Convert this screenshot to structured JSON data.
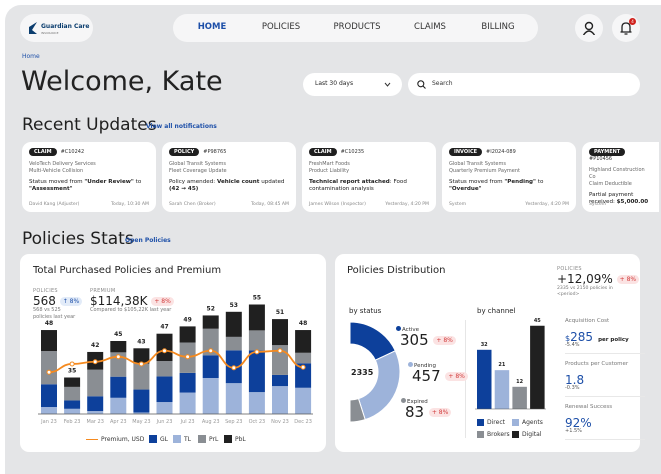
{
  "header": {
    "logo_text": "Guardian Care",
    "logo_sub": "INSURANCE",
    "nav": [
      "HOME",
      "POLICIES",
      "PRODUCTS",
      "CLAIMS",
      "BILLING"
    ],
    "active": "HOME",
    "notification_count": "4"
  },
  "breadcrumb": "Home",
  "welcome": "Welcome, Kate",
  "period_select": "Last 30 days",
  "search_placeholder": "Search",
  "recent": {
    "title": "Recent Updates",
    "link": "View all notifications",
    "cards": [
      {
        "tag": "CLAIM",
        "id": "#C10242",
        "company": "VeloTech Delivery Services",
        "subject": "Multi-Vehicle Collision",
        "msg_pre": "Status moved from ",
        "msg_b1": "\"Under Review\"",
        "msg_mid": " to ",
        "msg_b2": "\"Assessment\"",
        "author": "David Kang (Adjuster)",
        "time": "Today, 10:30 AM"
      },
      {
        "tag": "POLICY",
        "id": "#P98765",
        "company": "Global Transit Systems",
        "subject": "Fleet Coverage Update",
        "msg_pre": "Policy amended: ",
        "msg_b1": "Vehicle count",
        "msg_mid": " updated ",
        "msg_b2": "(42 → 45)",
        "author": "Sarah Chen (Broker)",
        "time": "Today, 08:45 AM"
      },
      {
        "tag": "CLAIM",
        "id": "#C10235",
        "company": "FreshMart Foods",
        "subject": "Product Liability",
        "msg_pre": "",
        "msg_b1": "Technical report attached",
        "msg_mid": ": Food contamination analysis",
        "msg_b2": "",
        "author": "James Wilson (Inspector)",
        "time": "Yesterday, 4:20 PM"
      },
      {
        "tag": "INVOICE",
        "id": "#I2024-089",
        "company": "Global Transit Systems",
        "subject": "Quarterly Premium Payment",
        "msg_pre": "Status moved from ",
        "msg_b1": "\"Pending\"",
        "msg_mid": " to ",
        "msg_b2": "\"Overdue\"",
        "author": "System",
        "time": "Yesterday, 4:20 PM"
      },
      {
        "tag": "PAYMENT",
        "id": "#P10456",
        "company": "Highland Construction Co",
        "subject": "Claim Deductible",
        "msg_pre": "Partial payment received: ",
        "msg_b1": "",
        "msg_mid": "",
        "msg_b2": "$5,000.00",
        "author": "System",
        "time": ""
      }
    ]
  },
  "stats": {
    "title": "Policies Stats",
    "link": "Open Policies"
  },
  "purchased": {
    "title": "Total Purchased Policies and Premium",
    "policies_label": "POLICIES",
    "policies_value": "568",
    "policies_change": "↑ 8%",
    "policies_sub": "568 vs 525 policies last year",
    "premium_label": "PREMIUM",
    "premium_value": "$114,38K",
    "premium_change": "+ 8%",
    "premium_sub": "Compared to $105,22K  last year"
  },
  "distribution": {
    "title": "Policies Distribution",
    "by_status": "by status",
    "by_channel": "by channel",
    "total": "2335",
    "status": [
      {
        "name": "Active",
        "value": "305",
        "change": "+ 8%"
      },
      {
        "name": "Pending",
        "value": "457",
        "change": "+ 8%"
      },
      {
        "name": "Expired",
        "value": "83",
        "change": "+ 8%"
      }
    ]
  },
  "side": {
    "policies_label": "POLICIES",
    "policies_value": "+12,09%",
    "policies_change": "+ 8%",
    "policies_sub": "2335 vs 2150 policies in <period>",
    "metrics": [
      {
        "label": "Acquisition Cost",
        "currency": "$",
        "value": "285",
        "unit": "per policy",
        "change": "-5.4%"
      },
      {
        "label": "Products per Customer",
        "currency": "",
        "value": "1.8",
        "unit": "",
        "change": "-0.3%"
      },
      {
        "label": "Renewal Success",
        "currency": "",
        "value": "92%",
        "unit": "",
        "change": "+1.5%"
      }
    ]
  },
  "colors": {
    "GL": "#0d409b",
    "TL": "#9db3da",
    "PrL": "#8a8e93",
    "PbL": "#202020",
    "premium": "#f58a1f",
    "accent": "#1d4fa8",
    "bg": "#e4e5e7"
  },
  "chart_data": [
    {
      "type": "bar",
      "stacked": true,
      "categories": [
        "Jan 23",
        "Feb 23",
        "Mar 23",
        "Apr 23",
        "May 23",
        "Jun 23",
        "Jul 23",
        "Aug 23",
        "Sep 23",
        "Oct 23",
        "Nov 23",
        "Dec 23"
      ],
      "totals": [
        48,
        35,
        42,
        45,
        43,
        47,
        49,
        52,
        53,
        55,
        51,
        48
      ],
      "series": [
        {
          "name": "GL",
          "values": [
            13,
            8,
            10,
            13,
            15,
            15,
            11,
            12,
            17,
            21,
            6,
            14
          ]
        },
        {
          "name": "TL",
          "values": [
            4,
            5,
            2,
            10,
            1,
            7,
            12,
            19,
            16,
            11,
            15,
            15
          ]
        },
        {
          "name": "PrL",
          "values": [
            19,
            13,
            18,
            15,
            17,
            9,
            17,
            14,
            7,
            10,
            16,
            6
          ]
        },
        {
          "name": "PbL",
          "values": [
            12,
            9,
            12,
            7,
            10,
            16,
            9,
            7,
            13,
            13,
            14,
            13
          ]
        }
      ],
      "line": {
        "name": "Premium, USD",
        "values": [
          7.6,
          9.1,
          9.5,
          10.4,
          9.1,
          11.5,
          10.4,
          11.5,
          8.4,
          11.3,
          11.5,
          8.5
        ]
      },
      "ylim": [
        25,
        57
      ],
      "legend": "bottom",
      "grid": false
    },
    {
      "type": "pie",
      "donut": true,
      "labels": [
        "Active",
        "Pending",
        "Expired"
      ],
      "values": [
        305,
        457,
        83
      ],
      "center_label": "2335"
    },
    {
      "type": "bar",
      "categories": [
        "Direct",
        "Agents",
        "Brokers",
        "Digital"
      ],
      "values": [
        32,
        21,
        12,
        45
      ],
      "legend": "bottom"
    }
  ]
}
